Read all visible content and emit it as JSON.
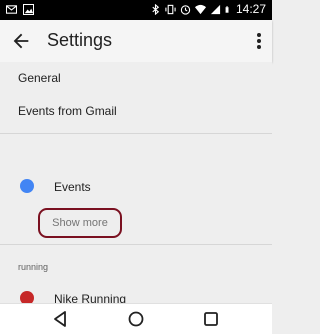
{
  "status_bar": {
    "time": "14:27",
    "icons": [
      "mail-icon",
      "image-icon",
      "bluetooth-icon",
      "vibrate-icon",
      "alarm-icon",
      "wifi-icon",
      "signal-icon",
      "battery-icon"
    ]
  },
  "app_bar": {
    "title": "Settings",
    "back_icon": "arrow-back-icon",
    "menu_icon": "more-vert-icon"
  },
  "settings": {
    "items": [
      {
        "label": "General"
      },
      {
        "label": "Events from Gmail"
      }
    ]
  },
  "calendars": {
    "events": {
      "label": "Events",
      "color": "#4285f4"
    },
    "show_more": "Show more"
  },
  "running": {
    "header": "running",
    "item_label": "Nike Running",
    "item_color": "#c62828"
  },
  "nav_bar": {
    "icons": [
      "back-triangle-icon",
      "home-circle-icon",
      "recents-square-icon"
    ]
  },
  "colors": {
    "accent_outline": "#7a1020"
  }
}
